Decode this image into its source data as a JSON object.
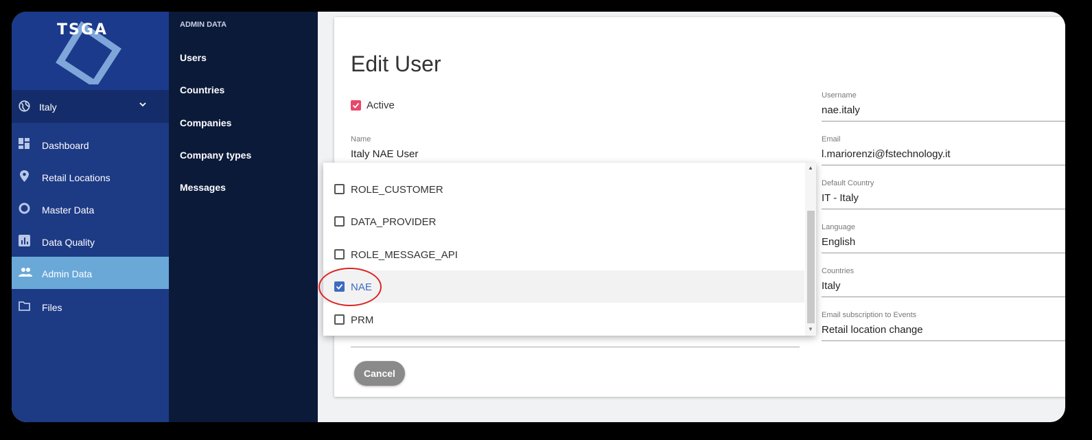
{
  "app": {
    "logo": "TSGA",
    "accent": "#6aa8d8"
  },
  "country_selector": {
    "value": "Italy"
  },
  "nav": [
    {
      "label": "Dashboard",
      "icon": "dashboard-icon"
    },
    {
      "label": "Retail Locations",
      "icon": "location-pin-icon"
    },
    {
      "label": "Master Data",
      "icon": "circle-icon"
    },
    {
      "label": "Data Quality",
      "icon": "bar-chart-icon"
    },
    {
      "label": "Admin Data",
      "icon": "people-icon",
      "active": true
    },
    {
      "label": "Files",
      "icon": "folder-icon"
    }
  ],
  "submenu": {
    "header": "ADMIN DATA",
    "items": [
      "Users",
      "Countries",
      "Companies",
      "Company types",
      "Messages"
    ]
  },
  "form": {
    "title": "Edit User",
    "active_label": "Active",
    "active_checked": true,
    "name": {
      "label": "Name",
      "value": "Italy NAE User"
    },
    "username": {
      "label": "Username",
      "value": "nae.italy"
    },
    "email": {
      "label": "Email",
      "value": "l.mariorenzi@fstechnology.it"
    },
    "default_country": {
      "label": "Default Country",
      "value": "IT - Italy"
    },
    "language": {
      "label": "Language",
      "value": "English"
    },
    "countries": {
      "label": "Countries",
      "value": "Italy"
    },
    "email_subscription": {
      "label": "Email subscription to Events",
      "value": "Retail location change"
    },
    "cancel_label": "Cancel"
  },
  "roles_dropdown": {
    "options": [
      {
        "label": "ROLE_CUSTOMER",
        "checked": false
      },
      {
        "label": "DATA_PROVIDER",
        "checked": false
      },
      {
        "label": "ROLE_MESSAGE_API",
        "checked": false
      },
      {
        "label": "NAE",
        "checked": true
      },
      {
        "label": "PRM",
        "checked": false
      }
    ]
  }
}
